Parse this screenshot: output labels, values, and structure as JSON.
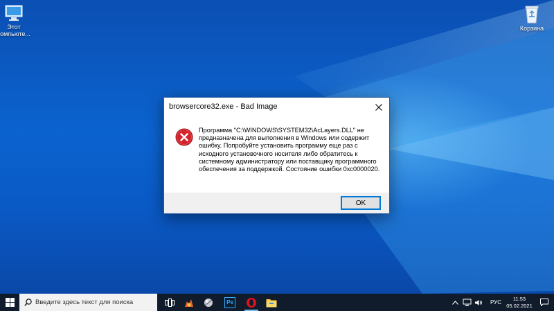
{
  "desktop": {
    "icons": [
      {
        "label": "Этот компьюте..."
      },
      {
        "label": "Корзина"
      }
    ]
  },
  "dialog": {
    "title": "browsercore32.exe - Bad Image",
    "message": "Программа \"C:\\WINDOWS\\SYSTEM32\\AcLayers.DLL\" не предназначена для выполнения в Windows или содержит ошибку. Попробуйте установить программу еще раз с исходного установочного носителя либо обратитесь к системному администратору или поставщику программного обеспечения за поддержкой. Состояние ошибки 0xc0000020.",
    "ok_label": "OK",
    "close_icon": "close-icon",
    "status_icon": "error-icon"
  },
  "taskbar": {
    "search_placeholder": "Введите здесь текст для поиска",
    "apps": [
      "task-view-icon",
      "game-icon",
      "3d-pinball-icon",
      "photoshop-icon",
      "opera-icon",
      "file-explorer-icon"
    ],
    "photoshop_label": "Ps",
    "tray": {
      "language": "РУС",
      "time": "11:53",
      "date": "05.02.2021"
    }
  },
  "colors": {
    "desktop_bg": "#0b5cc6",
    "taskbar_bg": "#101c2c",
    "accent": "#0078d7",
    "error_red": "#d3222a"
  }
}
